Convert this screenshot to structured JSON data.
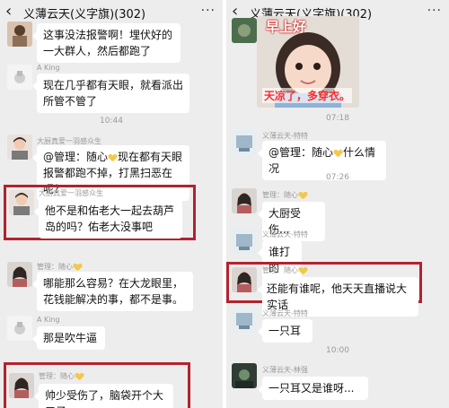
{
  "chat_title": "义薄云天(义字旗)(302)",
  "left": {
    "messages": [
      {
        "name": "",
        "text": "这事没法报警啊！埋伏好的一大群人，然后都跑了"
      },
      {
        "name": "A King",
        "text": "现在几乎都有天眼，就看派出所管不管了"
      },
      {
        "time": "10:44"
      },
      {
        "name": "大厨真爱一羽感众生",
        "text_prefix": "@管理：随心",
        "text_suffix": "现在都有天眼报警都跑不掉，打黑扫恶在呢？"
      },
      {
        "name": "大厨真爱一羽感众生",
        "text": "他不是和佑老大一起去葫芦岛的吗？佑老大没事吧"
      },
      {
        "name": "管理：随心",
        "text": "哪能那么容易？在大龙眼里，花钱能解决的事，都不是事。"
      },
      {
        "name": "A King",
        "text": "那是吹牛逼"
      },
      {
        "name": "管理：随心",
        "text": "帅少受伤了，脑袋开个大口子"
      }
    ]
  },
  "right": {
    "sticker": {
      "top_text": "早上好",
      "bottom_text": "天凉了，多穿衣。"
    },
    "messages": [
      {
        "time": "07:18"
      },
      {
        "name": "义薄云天-特特",
        "text_prefix": "@管理：随心",
        "text_suffix": "什么情况"
      },
      {
        "time": "07:26"
      },
      {
        "name": "管理：随心",
        "text": "大厨受伤..."
      },
      {
        "name": "义薄云天-特特",
        "text": "谁打的"
      },
      {
        "name": "管理：随心",
        "text": "还能有谁呢，他天天直播说大实话"
      },
      {
        "name": "义薄云天-特特",
        "text": "一只耳"
      },
      {
        "time": "10:00"
      },
      {
        "name": "义薄云天-林强",
        "text": "一只耳又是谁呀..."
      }
    ]
  }
}
